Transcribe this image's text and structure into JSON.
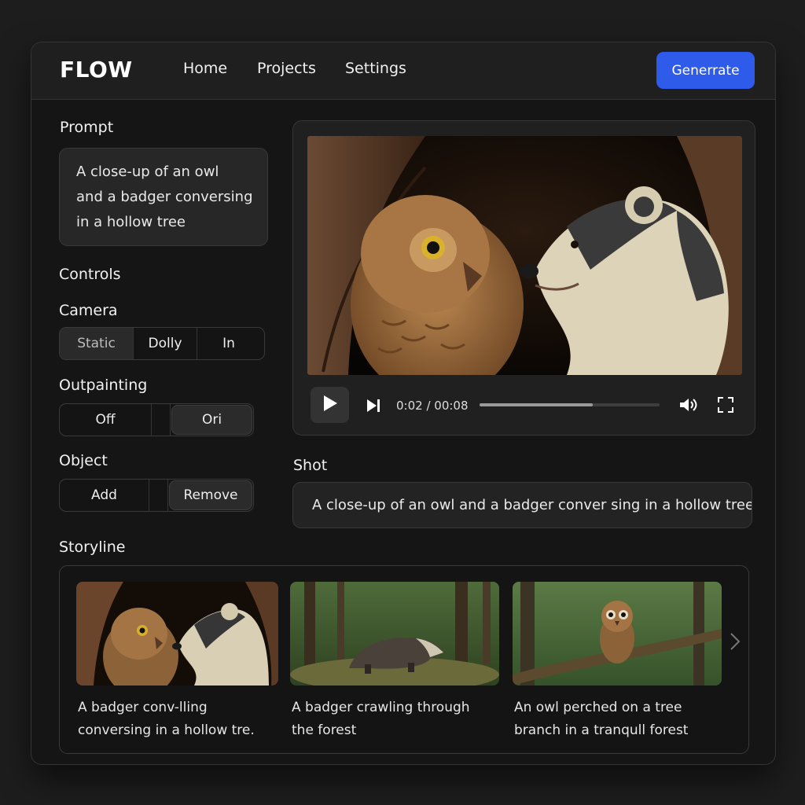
{
  "app": {
    "logo": "FLOW"
  },
  "nav": {
    "home": "Home",
    "projects": "Projects",
    "settings": "Settings"
  },
  "header": {
    "generate_label": "Generrate"
  },
  "prompt": {
    "label": "Prompt",
    "lines": [
      "A close-up of an owl",
      "and a badger conversing",
      "in a hollow tree"
    ]
  },
  "controls": {
    "label": "Controls",
    "camera": {
      "label": "Camera",
      "options": [
        "Static",
        "Dolly",
        "In"
      ],
      "selected": "Static"
    },
    "outpainting": {
      "label": "Outpainting",
      "options": [
        "Off",
        "Ori"
      ],
      "selected": "Ori"
    },
    "object": {
      "label": "Object",
      "options": [
        "Add",
        "Remove"
      ],
      "selected": "Remove"
    }
  },
  "player": {
    "time": "0:02 / 00:08",
    "progress": 0.63,
    "icons": [
      "play-icon",
      "skip-next-icon",
      "volume-icon",
      "fullscreen-icon"
    ]
  },
  "shot": {
    "label": "Shot",
    "text": "A close-up of an owl and a badger conver sing in a hollow tree"
  },
  "storyline": {
    "label": "Storyline",
    "cards": [
      {
        "caption_lines": [
          "A badger conv-lling",
          "conversing in a hollow tre."
        ]
      },
      {
        "caption_lines": [
          "A badger crawling through",
          "the forest"
        ]
      },
      {
        "caption_lines": [
          "An owl perched on a tree",
          "branch in a tranqull forest"
        ]
      }
    ],
    "next_icon": "chevron-right-icon"
  },
  "colors": {
    "accent": "#2f5bea",
    "panel": "#202020",
    "background": "#151515"
  }
}
